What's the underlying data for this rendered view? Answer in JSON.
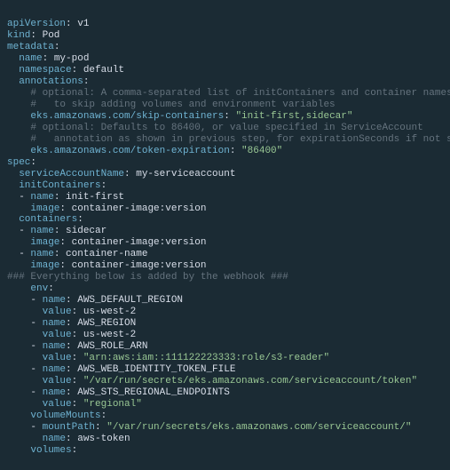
{
  "codeLines": [
    [
      [
        "k",
        "apiVersion"
      ],
      [
        "w",
        ": "
      ],
      [
        "w",
        "v1"
      ]
    ],
    [
      [
        "k",
        "kind"
      ],
      [
        "w",
        ": "
      ],
      [
        "w",
        "Pod"
      ]
    ],
    [
      [
        "k",
        "metadata"
      ],
      [
        "w",
        ":"
      ]
    ],
    [
      [
        "w",
        "  "
      ],
      [
        "k",
        "name"
      ],
      [
        "w",
        ": "
      ],
      [
        "w",
        "my-pod"
      ]
    ],
    [
      [
        "w",
        "  "
      ],
      [
        "k",
        "namespace"
      ],
      [
        "w",
        ": "
      ],
      [
        "w",
        "default"
      ]
    ],
    [
      [
        "w",
        "  "
      ],
      [
        "k",
        "annotations"
      ],
      [
        "w",
        ":"
      ]
    ],
    [
      [
        "w",
        "    "
      ],
      [
        "c",
        "# optional: A comma-separated list of initContainers and container names"
      ]
    ],
    [
      [
        "w",
        "    "
      ],
      [
        "c",
        "#   to skip adding volumes and environment variables"
      ]
    ],
    [
      [
        "w",
        "    "
      ],
      [
        "k",
        "eks.amazonaws.com/skip-containers"
      ],
      [
        "w",
        ": "
      ],
      [
        "s",
        "\"init-first,sidecar\""
      ]
    ],
    [
      [
        "w",
        "    "
      ],
      [
        "c",
        "# optional: Defaults to 86400, or value specified in ServiceAccount"
      ]
    ],
    [
      [
        "w",
        "    "
      ],
      [
        "c",
        "#   annotation as shown in previous step, for expirationSeconds if not set"
      ]
    ],
    [
      [
        "w",
        "    "
      ],
      [
        "k",
        "eks.amazonaws.com/token-expiration"
      ],
      [
        "w",
        ": "
      ],
      [
        "s",
        "\"86400\""
      ]
    ],
    [
      [
        "k",
        "spec"
      ],
      [
        "w",
        ":"
      ]
    ],
    [
      [
        "w",
        "  "
      ],
      [
        "k",
        "serviceAccountName"
      ],
      [
        "w",
        ": "
      ],
      [
        "w",
        "my-serviceaccount"
      ]
    ],
    [
      [
        "w",
        "  "
      ],
      [
        "k",
        "initContainers"
      ],
      [
        "w",
        ":"
      ]
    ],
    [
      [
        "w",
        "  - "
      ],
      [
        "k",
        "name"
      ],
      [
        "w",
        ": "
      ],
      [
        "w",
        "init-first"
      ]
    ],
    [
      [
        "w",
        "    "
      ],
      [
        "k",
        "image"
      ],
      [
        "w",
        ": "
      ],
      [
        "w",
        "container-image:version"
      ]
    ],
    [
      [
        "w",
        "  "
      ],
      [
        "k",
        "containers"
      ],
      [
        "w",
        ":"
      ]
    ],
    [
      [
        "w",
        "  - "
      ],
      [
        "k",
        "name"
      ],
      [
        "w",
        ": "
      ],
      [
        "w",
        "sidecar"
      ]
    ],
    [
      [
        "w",
        "    "
      ],
      [
        "k",
        "image"
      ],
      [
        "w",
        ": "
      ],
      [
        "w",
        "container-image:version"
      ]
    ],
    [
      [
        "w",
        "  - "
      ],
      [
        "k",
        "name"
      ],
      [
        "w",
        ": "
      ],
      [
        "w",
        "container-name"
      ]
    ],
    [
      [
        "w",
        "    "
      ],
      [
        "k",
        "image"
      ],
      [
        "w",
        ": "
      ],
      [
        "w",
        "container-image:version"
      ]
    ],
    [
      [
        "c",
        "### Everything below is added by the webhook ###"
      ]
    ],
    [
      [
        "w",
        "    "
      ],
      [
        "k",
        "env"
      ],
      [
        "w",
        ":"
      ]
    ],
    [
      [
        "w",
        "    - "
      ],
      [
        "k",
        "name"
      ],
      [
        "w",
        ": "
      ],
      [
        "w",
        "AWS_DEFAULT_REGION"
      ]
    ],
    [
      [
        "w",
        "      "
      ],
      [
        "k",
        "value"
      ],
      [
        "w",
        ": "
      ],
      [
        "w",
        "us-west-2"
      ]
    ],
    [
      [
        "w",
        "    - "
      ],
      [
        "k",
        "name"
      ],
      [
        "w",
        ": "
      ],
      [
        "w",
        "AWS_REGION"
      ]
    ],
    [
      [
        "w",
        "      "
      ],
      [
        "k",
        "value"
      ],
      [
        "w",
        ": "
      ],
      [
        "w",
        "us-west-2"
      ]
    ],
    [
      [
        "w",
        "    - "
      ],
      [
        "k",
        "name"
      ],
      [
        "w",
        ": "
      ],
      [
        "w",
        "AWS_ROLE_ARN"
      ]
    ],
    [
      [
        "w",
        "      "
      ],
      [
        "k",
        "value"
      ],
      [
        "w",
        ": "
      ],
      [
        "s",
        "\"arn:aws:iam::111122223333:role/s3-reader\""
      ]
    ],
    [
      [
        "w",
        "    - "
      ],
      [
        "k",
        "name"
      ],
      [
        "w",
        ": "
      ],
      [
        "w",
        "AWS_WEB_IDENTITY_TOKEN_FILE"
      ]
    ],
    [
      [
        "w",
        "      "
      ],
      [
        "k",
        "value"
      ],
      [
        "w",
        ": "
      ],
      [
        "s",
        "\"/var/run/secrets/eks.amazonaws.com/serviceaccount/token\""
      ]
    ],
    [
      [
        "w",
        "    - "
      ],
      [
        "k",
        "name"
      ],
      [
        "w",
        ": "
      ],
      [
        "w",
        "AWS_STS_REGIONAL_ENDPOINTS"
      ]
    ],
    [
      [
        "w",
        "      "
      ],
      [
        "k",
        "value"
      ],
      [
        "w",
        ": "
      ],
      [
        "s",
        "\"regional\""
      ]
    ],
    [
      [
        "w",
        "    "
      ],
      [
        "k",
        "volumeMounts"
      ],
      [
        "w",
        ":"
      ]
    ],
    [
      [
        "w",
        "    - "
      ],
      [
        "k",
        "mountPath"
      ],
      [
        "w",
        ": "
      ],
      [
        "s",
        "\"/var/run/secrets/eks.amazonaws.com/serviceaccount/\""
      ]
    ],
    [
      [
        "w",
        "      "
      ],
      [
        "k",
        "name"
      ],
      [
        "w",
        ": "
      ],
      [
        "w",
        "aws-token"
      ]
    ],
    [
      [
        "w",
        "    "
      ],
      [
        "k",
        "volumes"
      ],
      [
        "w",
        ":"
      ]
    ]
  ]
}
